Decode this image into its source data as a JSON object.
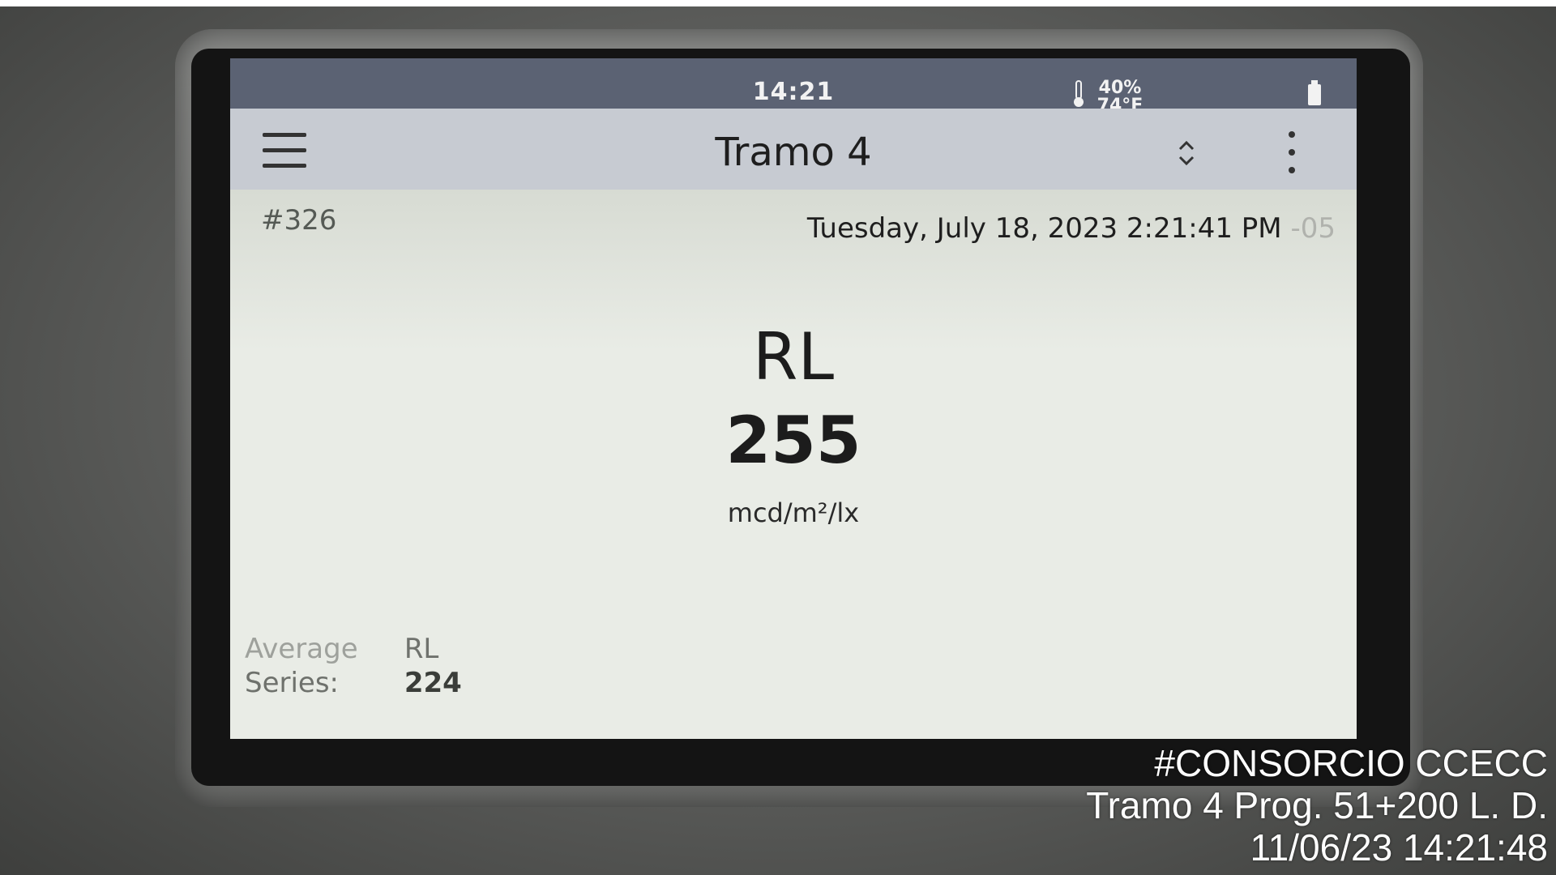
{
  "status_bar": {
    "time": "14:21",
    "humidity": "40%",
    "temperature": "74°F"
  },
  "title_bar": {
    "title": "Tramo 4"
  },
  "measurement": {
    "record_number": "#326",
    "datetime": "Tuesday, July 18, 2023 2:21:41 PM",
    "timezone": "-05",
    "label": "RL",
    "value": "255",
    "unit": "mcd/m²/lx"
  },
  "average_series": {
    "label_line1": "Average",
    "label_line2": "Series:",
    "metric": "RL",
    "value": "224"
  },
  "photo_overlay": {
    "line1": "#CONSORCIO CCECC",
    "line2": "Tramo 4 Prog. 51+200 L. D.",
    "line3": "11/06/23  14:21:48"
  },
  "icons": {
    "menu": "hamburger-icon",
    "thermometer": "thermometer-icon",
    "battery": "battery-icon",
    "sort": "up-down-chevron-icon",
    "more": "vertical-dots-icon"
  }
}
